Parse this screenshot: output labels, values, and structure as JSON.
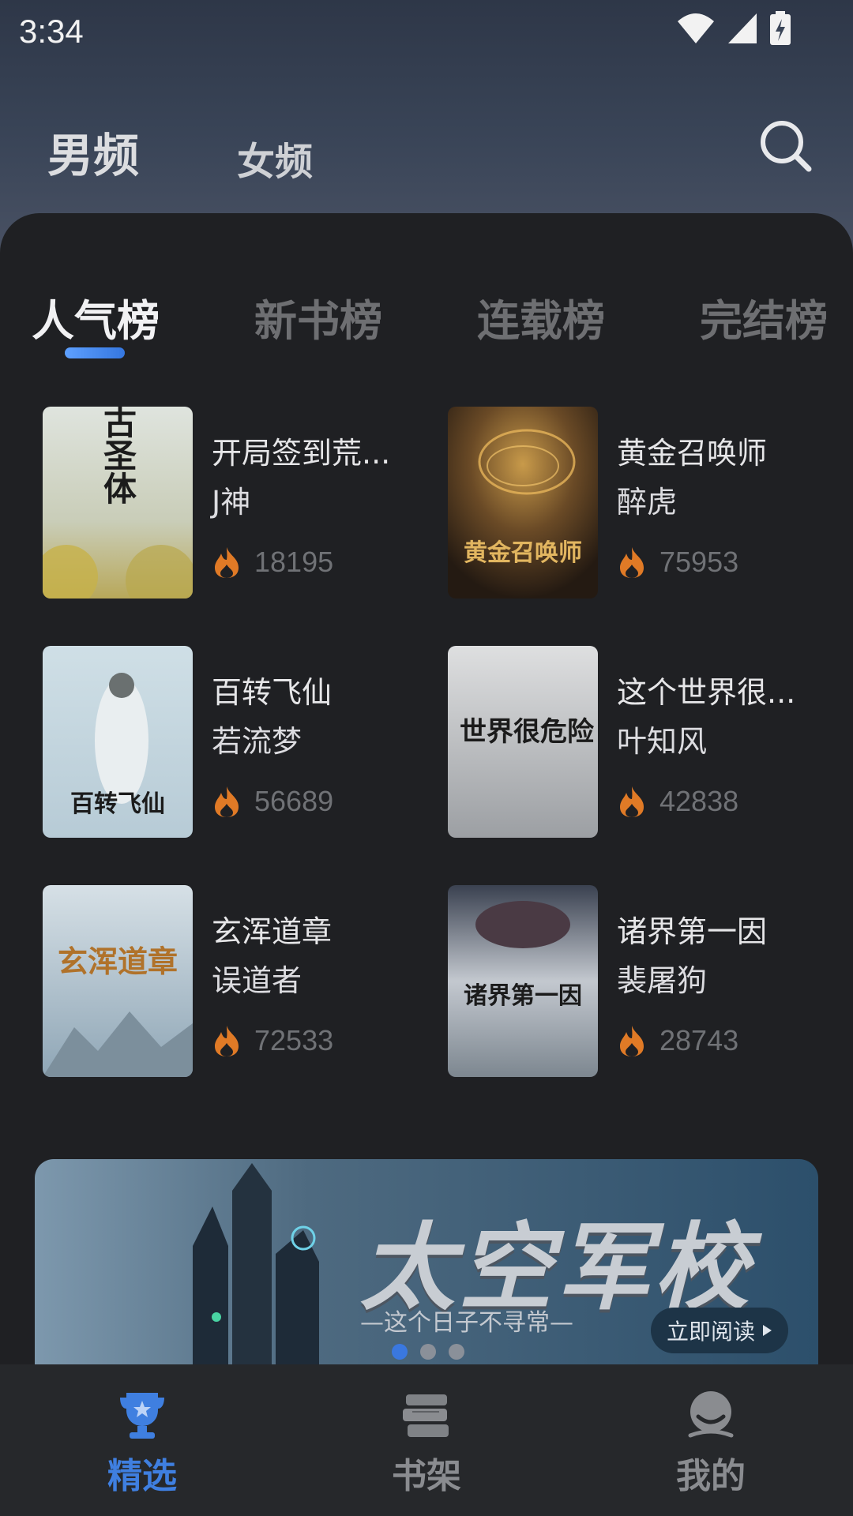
{
  "status_bar": {
    "time": "3:34"
  },
  "gender_tabs": [
    {
      "label": "男频",
      "active": true
    },
    {
      "label": "女频",
      "active": false
    }
  ],
  "rank_tabs": [
    {
      "label": "人气榜",
      "active": true
    },
    {
      "label": "新书榜",
      "active": false
    },
    {
      "label": "连载榜",
      "active": false
    },
    {
      "label": "完结榜",
      "active": false
    }
  ],
  "books": [
    {
      "title": "开局签到荒...",
      "author": "J神",
      "heat": "18195",
      "cover_text": "荒古圣体"
    },
    {
      "title": "黄金召唤师",
      "author": "醉虎",
      "heat": "75953",
      "cover_text": "黄金召唤师"
    },
    {
      "title": "百转飞仙",
      "author": "若流梦",
      "heat": "56689",
      "cover_text": "百转飞仙"
    },
    {
      "title": "这个世界很...",
      "author": "叶知风",
      "heat": "42838",
      "cover_text": "世界很危险"
    },
    {
      "title": "玄浑道章",
      "author": "误道者",
      "heat": "72533",
      "cover_text": "玄浑道章"
    },
    {
      "title": "诸界第一因",
      "author": "裴屠狗",
      "heat": "28743",
      "cover_text": "诸界第一因"
    }
  ],
  "banner": {
    "title": "太空军校",
    "subtitle": "—这个日子不寻常—",
    "button_label": "立即阅读"
  },
  "bottom_nav": [
    {
      "label": "精选",
      "icon": "trophy-icon",
      "active": true
    },
    {
      "label": "书架",
      "icon": "bookshelf-icon",
      "active": false
    },
    {
      "label": "我的",
      "icon": "profile-icon",
      "active": false
    }
  ],
  "colors": {
    "accent": "#3f7fe0",
    "background": "#1f2023",
    "heat_icon": "#e07a26"
  }
}
